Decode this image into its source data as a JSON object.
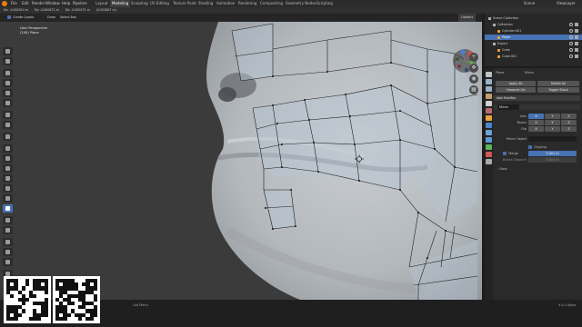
{
  "topbar": {
    "menus": [
      "File",
      "Edit",
      "Render",
      "Window",
      "Help",
      "Pipeline"
    ],
    "workspaces": [
      "Layout",
      "Modeling",
      "Sculpting",
      "UV Editing",
      "Texture Paint",
      "Shading",
      "Animation",
      "Rendering",
      "Compositing",
      "Geometry Nodes",
      "Scripting"
    ],
    "active_workspace": "Modeling",
    "scene": "Scene",
    "view_layer": "ViewLayer"
  },
  "infobar": {
    "items": [
      "Dx: -0.000314 m",
      "Dy: -0.000471 m",
      "Dz: -0.000171 m",
      "(0.001807 m)"
    ]
  },
  "viewport_header": {
    "create_quads_label": "Create Quads",
    "draw_label": "Draw",
    "select_box_label": "Select Box",
    "options_label": "Options"
  },
  "viewport": {
    "view_name": "User Perspective",
    "object_label": "(200) Plane"
  },
  "outliner": {
    "title": "Scene Collection",
    "rows": [
      {
        "label": "Collection",
        "color": "#b0b0b0",
        "indent": 1
      },
      {
        "label": "Cylinder.001",
        "color": "#e89c3a",
        "indent": 2
      },
      {
        "label": "Plane",
        "color": "#e89c3a",
        "indent": 2,
        "selected": true
      },
      {
        "label": "Export",
        "color": "#b0b0b0",
        "indent": 1
      },
      {
        "label": "Cube",
        "color": "#e89c3a",
        "indent": 2
      },
      {
        "label": "Cube.001",
        "color": "#e89c3a",
        "indent": 2
      }
    ]
  },
  "properties": {
    "object_name": "Plane",
    "modifier_tab": "Mirror",
    "apply_all": "Apply All",
    "delete_all": "Delete All",
    "viewport_vis": "Viewport Vis",
    "toggle_stack": "Toggle Stack",
    "add_modifier": "Add Modifier",
    "modifier_name": "Mirror",
    "axis_label": "Axis",
    "bisect_label": "Bisect",
    "flip_label": "Flip",
    "axes": [
      "X",
      "Y",
      "Z"
    ],
    "mirror_object_label": "Mirror Object",
    "clipping_label": "Clipping",
    "merge_label": "Merge",
    "merge_value": "0.001 m",
    "bisect_distance_label": "Bisect Distance",
    "bisect_distance_value": "0.001 m",
    "data_label": "Data"
  },
  "statusbar": {
    "center_text": "Call Menu",
    "version": "4.0.0 Alpha"
  },
  "colors": {
    "accent": "#4772b3",
    "orange": "#e87d0d",
    "mesh_skin": "#b9bec3",
    "wire": "#1a1a1a"
  }
}
